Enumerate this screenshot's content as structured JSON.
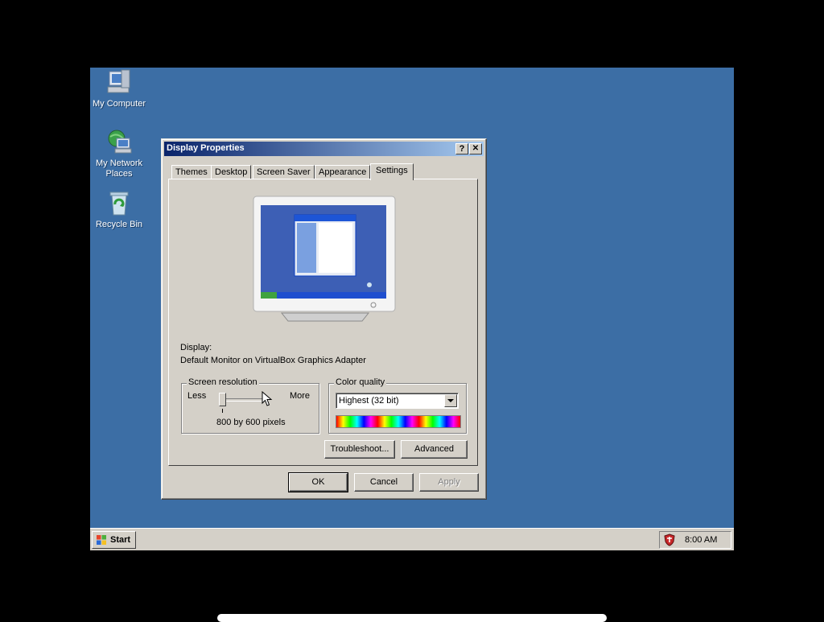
{
  "desktop": {
    "icons": [
      {
        "label": "My Computer",
        "icon": "my-computer-icon"
      },
      {
        "label": "My Network\nPlaces",
        "icon": "network-places-icon"
      },
      {
        "label": "Recycle Bin",
        "icon": "recycle-bin-icon"
      }
    ],
    "background_color": "#3c6ea5"
  },
  "window": {
    "title": "Display Properties",
    "help_button": "?",
    "close_button": "✕",
    "tabs": [
      {
        "label": "Themes"
      },
      {
        "label": "Desktop"
      },
      {
        "label": "Screen Saver"
      },
      {
        "label": "Appearance"
      },
      {
        "label": "Settings",
        "active": true
      }
    ],
    "display_label": "Display:",
    "display_value": "Default Monitor on VirtualBox Graphics Adapter",
    "resolution": {
      "legend": "Screen resolution",
      "less": "Less",
      "more": "More",
      "value_text": "800 by 600 pixels"
    },
    "color_quality": {
      "legend": "Color quality",
      "selected": "Highest (32 bit)"
    },
    "buttons": {
      "troubleshoot": "Troubleshoot...",
      "advanced": "Advanced",
      "ok": "OK",
      "cancel": "Cancel",
      "apply": "Apply"
    }
  },
  "taskbar": {
    "start_label": "Start",
    "clock": "8:00 AM"
  }
}
